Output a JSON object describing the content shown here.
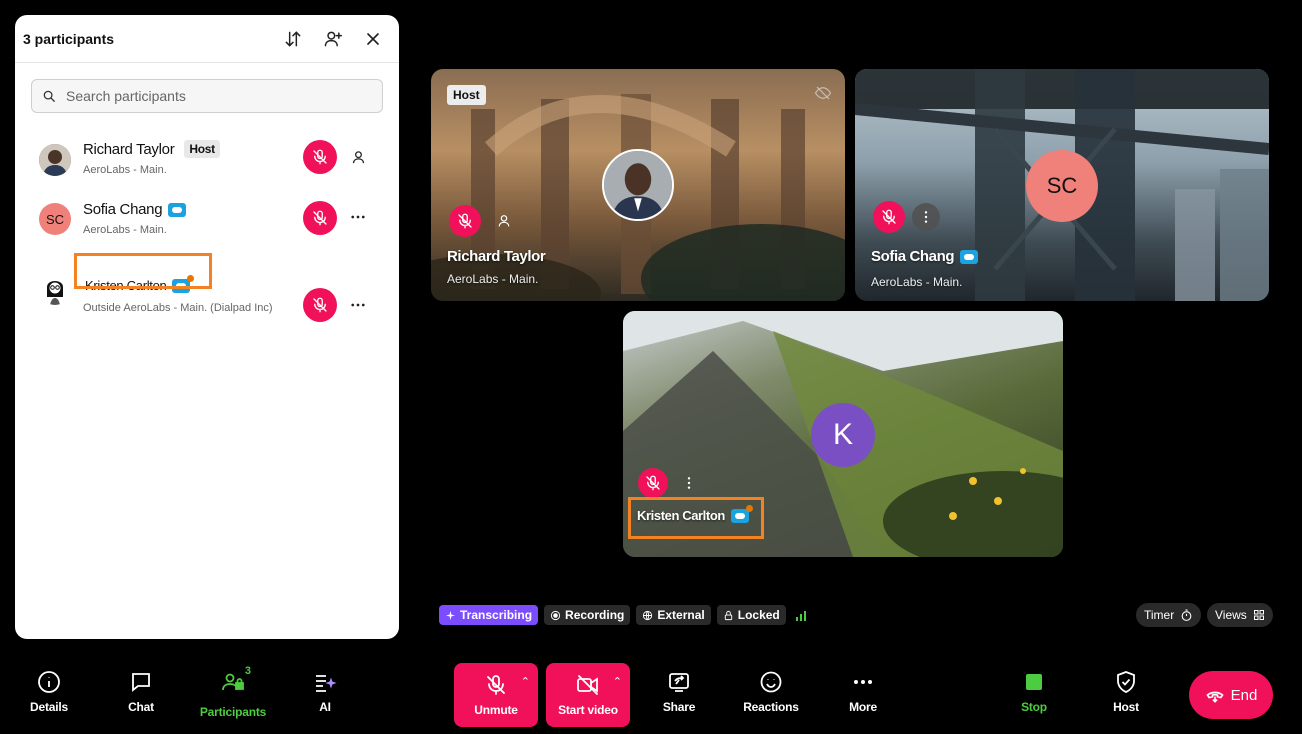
{
  "panel": {
    "title": "3 participants",
    "search_placeholder": "Search participants",
    "participants": [
      {
        "name": "Richard Taylor",
        "badge": "Host",
        "org": "AeroLabs - Main."
      },
      {
        "name": "Sofia Chang",
        "initials": "SC",
        "org": "AeroLabs - Main."
      },
      {
        "name": "Kristen Carlton",
        "org": "Outside AeroLabs - Main. (Dialpad Inc)"
      }
    ]
  },
  "tiles": {
    "richard": {
      "badge": "Host",
      "name": "Richard Taylor",
      "org": "AeroLabs - Main."
    },
    "sofia": {
      "initials": "SC",
      "name": "Sofia Chang",
      "org": "AeroLabs - Main."
    },
    "kristen": {
      "initial": "K",
      "name": "Kristen Carlton"
    }
  },
  "status": {
    "transcribing": "Transcribing",
    "recording": "Recording",
    "external": "External",
    "locked": "Locked",
    "timer": "Timer",
    "views": "Views"
  },
  "toolbar": {
    "details": "Details",
    "chat": "Chat",
    "participants": "Participants",
    "participants_count": "3",
    "ai": "AI",
    "unmute": "Unmute",
    "start_video": "Start video",
    "share": "Share",
    "reactions": "Reactions",
    "more": "More",
    "stop": "Stop",
    "host": "Host",
    "end": "End"
  },
  "colors": {
    "accent_red": "#f0115a",
    "participants_green": "#4ccd3f",
    "highlight_orange": "#f58220",
    "sofia_avatar": "#f0807a",
    "kristen_avatar": "#7b4fc4",
    "transcribing_purple": "#7c4dff"
  }
}
